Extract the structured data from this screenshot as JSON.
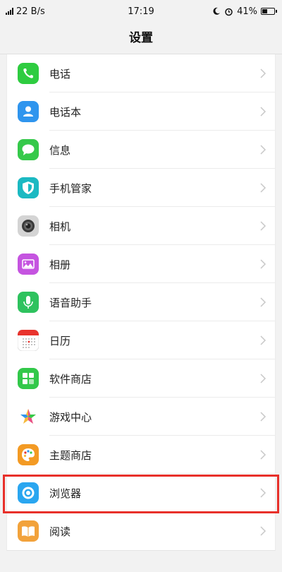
{
  "status_bar": {
    "network_speed": "22 B/s",
    "time": "17:19",
    "battery_percent": "41%",
    "battery_level": 0.41
  },
  "header": {
    "title": "设置"
  },
  "items": [
    {
      "label": "电话",
      "icon": "phone-icon",
      "color": "#2ecc40"
    },
    {
      "label": "电话本",
      "icon": "contacts-icon",
      "color": "#2f95ee"
    },
    {
      "label": "信息",
      "icon": "message-icon",
      "color": "#35c94a"
    },
    {
      "label": "手机管家",
      "icon": "shield-icon",
      "color": "#1bb9c2"
    },
    {
      "label": "相机",
      "icon": "camera-icon",
      "color": "#cfcfcf"
    },
    {
      "label": "相册",
      "icon": "gallery-icon",
      "color": "#c554e0"
    },
    {
      "label": "语音助手",
      "icon": "microphone-icon",
      "color": "#2ec25e"
    },
    {
      "label": "日历",
      "icon": "calendar-icon",
      "color": "#ffffff"
    },
    {
      "label": "软件商店",
      "icon": "app-store-icon",
      "color": "#32c84a"
    },
    {
      "label": "游戏中心",
      "icon": "game-center-icon",
      "color": "#ffffff"
    },
    {
      "label": "主题商店",
      "icon": "palette-icon",
      "color": "#f39a24"
    },
    {
      "label": "浏览器",
      "icon": "browser-icon",
      "color": "#2aa6f0"
    },
    {
      "label": "阅读",
      "icon": "book-icon",
      "color": "#f2a23b"
    }
  ]
}
